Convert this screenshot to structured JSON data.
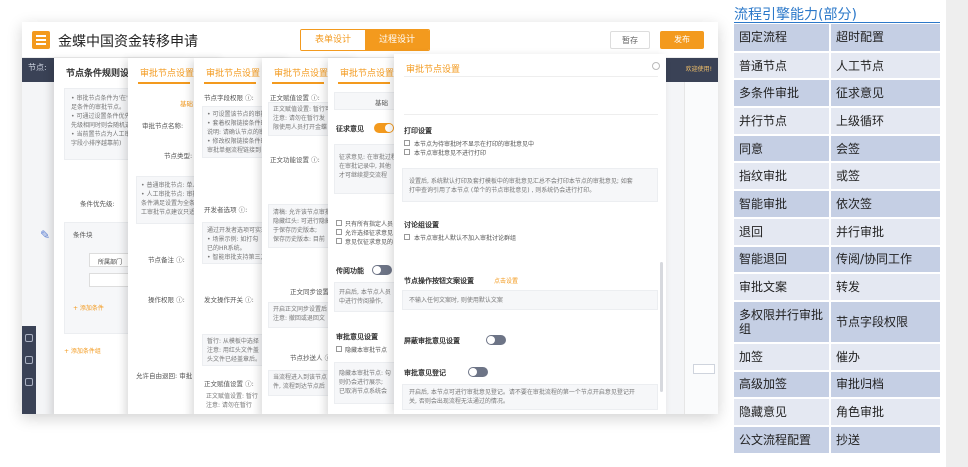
{
  "app": {
    "title": "金蝶中国资金转移申请",
    "tab_form": "表单设计",
    "tab_flow": "过程设计",
    "save": "暂存",
    "publish": "发布",
    "node_label": "节点:",
    "hint": "欢迎使用!"
  },
  "panel1": {
    "title": "节点条件规则设置",
    "lines": [
      "• 审批节点条件为'在', '不在'条件时,满",
      "足条件的审批节点。",
      "• 可通过设置条件优先级",
      "先级相同时则会随机选择一条",
      "• 当前置节点为人工审批节点时,可设置",
      "字段小排序越靠前)"
    ],
    "priority": "条件优先级:",
    "group": "条件块",
    "dept": "所属部门",
    "add_cond": "+ 添加条件",
    "add_group": "+ 添加条件组"
  },
  "panel2": {
    "title": "审批节点设置",
    "basic": "基础",
    "node_name": "审批节点名称:",
    "node_type": "节点类型:",
    "lines": [
      "• 普通审批节点: 单人审批",
      "• 人工审批节点: 审批人可指定",
      "条件满足设置为全条件满足",
      "工审批节点建议只适用于"
    ],
    "remark": "节点备注 ⓘ:",
    "op_perm": "操作权限 ⓘ:",
    "self_return": "允许自由退回: 审批"
  },
  "panel3": {
    "title": "审批节点设置",
    "field_perm": "节点字段权限 ⓘ:",
    "lines1": [
      "• 可设置该节点的审批字段",
      "• 套着权限链接条件时",
      "说明: 请确认节点的审",
      "• 修改权限链接条件时",
      "审批单据流程链接到"
    ],
    "cosign": "开发者选项 ⓘ:",
    "lines2": [
      "通过开发者选项可实现",
      "• 场景示例: 如打勾",
      "已的HR系统。",
      "• 智能审批支持第三方"
    ],
    "doc_perm": "发文操作开关 ⓘ:",
    "lines3": [
      "暂行: 从模板中选择",
      "注意: 用红头文件盖",
      "头文件已经盖章后。"
    ],
    "doc_copy": "正文赋值设置 ⓘ:",
    "lines4": [
      "正文赋值设置: 暂行",
      "注意: 请勿在暂行"
    ]
  },
  "panel4": {
    "title": "审批节点设置",
    "doc_copy": "正文赋值设置 ⓘ:",
    "lines1": [
      "正文赋值设置: 暂行可",
      "注意: 请勿在暂行发",
      "限使用人员打开金蝶"
    ],
    "doc_func": "正文功能设置 ⓘ:",
    "lines2": [
      "清稿: 允许该节点审批",
      "隐藏红头: 可进行隐藏",
      "于保存历史版本;",
      "保存历史版本: 目前"
    ],
    "doc_sync": "正文同步设置:",
    "lines3": [
      "开启正文同步设置后",
      "注意: 撤回或退回文"
    ],
    "cc": "节点抄送人 ⓘ:",
    "lines4": [
      "当流程进入到该节点",
      "件, 流程到达节点后"
    ]
  },
  "panel5": {
    "title": "审批节点设置",
    "basic": "基础",
    "opinion": "征求意见",
    "lines1": [
      "征求意见: 在审批过程中",
      "在审批记录中, 其他",
      "才可继续提交流程"
    ],
    "cbs": [
      "只有所有指定人员",
      "允许选择征求意见",
      "意见仅征求意见的"
    ],
    "circulate": "传阅功能",
    "lines2": [
      "开启后, 本节点人员",
      "中进行传阅操作,"
    ],
    "hide_opinion_setting": "审批意见设置",
    "hide_node": "隐藏本审批节点",
    "lines3": [
      "隐藏本审批节点: 勾",
      "则仍会进行展示;",
      "已取消节点系统会"
    ]
  },
  "panel6": {
    "title": "审批节点设置",
    "print": "打印设置",
    "print_cb1": "本节点为待审批时不显示在打印的审批意见中",
    "print_cb2": "本节点审批意见不进行打印",
    "print_desc1": "设置后, 系统默认打印及套打模板中的审批意见汇总不会打印本节点的审批意见; 如套",
    "print_desc2": "打申查询引用了本节点 (单个的节点审批意见) , 则系统仍会进行打印。",
    "discuss": "讨论组设置",
    "discuss_cb": "本节点审批人默认不加入审批讨论群组",
    "btn_text": "节点操作按钮文案设置",
    "btn_link": "点击设置",
    "btn_desc": "不输入任何文案时, 则使用默认文案",
    "hide_opinion": "屏蔽审批意见设置",
    "must_opinion": "审批意见登记",
    "must_desc1": "开启后, 本节点可进行审批意见登记。请不要在审批流程的第一个节点开启意见登记开",
    "must_desc2": "关, 否则会出现流程无法通过的情况。"
  },
  "capability": {
    "title": "流程引擎能力(部分)",
    "rows": [
      [
        "固定流程",
        "超时配置"
      ],
      [
        "普通节点",
        "人工节点"
      ],
      [
        "多条件审批",
        "征求意见"
      ],
      [
        "并行节点",
        "上级循环"
      ],
      [
        "同意",
        "会签"
      ],
      [
        "指纹审批",
        "或签"
      ],
      [
        "智能审批",
        "依次签"
      ],
      [
        "退回",
        "并行审批"
      ],
      [
        "智能退回",
        "传阅/协同工作"
      ],
      [
        "审批文案",
        "转发"
      ],
      [
        "多权限并行审批组",
        "节点字段权限"
      ],
      [
        "加签",
        "催办"
      ],
      [
        "高级加签",
        "审批归档"
      ],
      [
        "隐藏意见",
        "角色审批"
      ],
      [
        "公文流程配置",
        "抄送"
      ]
    ]
  },
  "colors": {
    "accent": "#f39a1e",
    "table_dark": "#c5cfe4",
    "table_light": "#e4e8f2",
    "title_blue": "#2b78c9"
  }
}
